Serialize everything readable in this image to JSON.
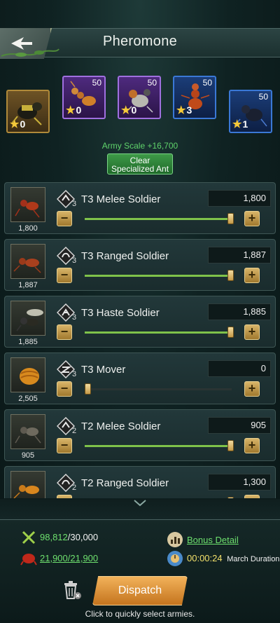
{
  "header": {
    "title": "Pheromone"
  },
  "ant_cards": [
    {
      "count": "",
      "stars": "0",
      "color": "gold"
    },
    {
      "count": "50",
      "stars": "0",
      "color": "purple"
    },
    {
      "count": "50",
      "stars": "0",
      "color": "purple"
    },
    {
      "count": "50",
      "stars": "3",
      "color": "blue"
    },
    {
      "count": "50",
      "stars": "1",
      "color": "blue"
    }
  ],
  "army_scale": "Army Scale +16,700",
  "clear_button": "Clear Specialized Ant",
  "troops": [
    {
      "name": "T3 Melee Soldier",
      "rank": "3",
      "owned": "1,800",
      "selected": "1,800",
      "fill": 1.0
    },
    {
      "name": "T3 Ranged Soldier",
      "rank": "3",
      "owned": "1,887",
      "selected": "1,887",
      "fill": 1.0
    },
    {
      "name": "T3 Haste Soldier",
      "rank": "3",
      "owned": "1,885",
      "selected": "1,885",
      "fill": 1.0
    },
    {
      "name": "T3 Mover",
      "rank": "3",
      "owned": "2,505",
      "selected": "0",
      "fill": 0.0
    },
    {
      "name": "T2 Melee Soldier",
      "rank": "2",
      "owned": "905",
      "selected": "905",
      "fill": 1.0
    },
    {
      "name": "T2 Ranged Soldier",
      "rank": "2",
      "owned": "",
      "selected": "1,300",
      "fill": 1.0
    }
  ],
  "footer": {
    "power": "98,812",
    "power_limit": "/30,000",
    "capacity": "21,900/21,900",
    "bonus_detail": "Bonus Detail",
    "march_time": "00:00:24",
    "march_label": "March Duration",
    "dispatch": "Dispatch",
    "hint": "Click to quickly select armies."
  },
  "colors": {
    "accent_green": "#6ee06e",
    "button_gold": "#e0a04a"
  }
}
